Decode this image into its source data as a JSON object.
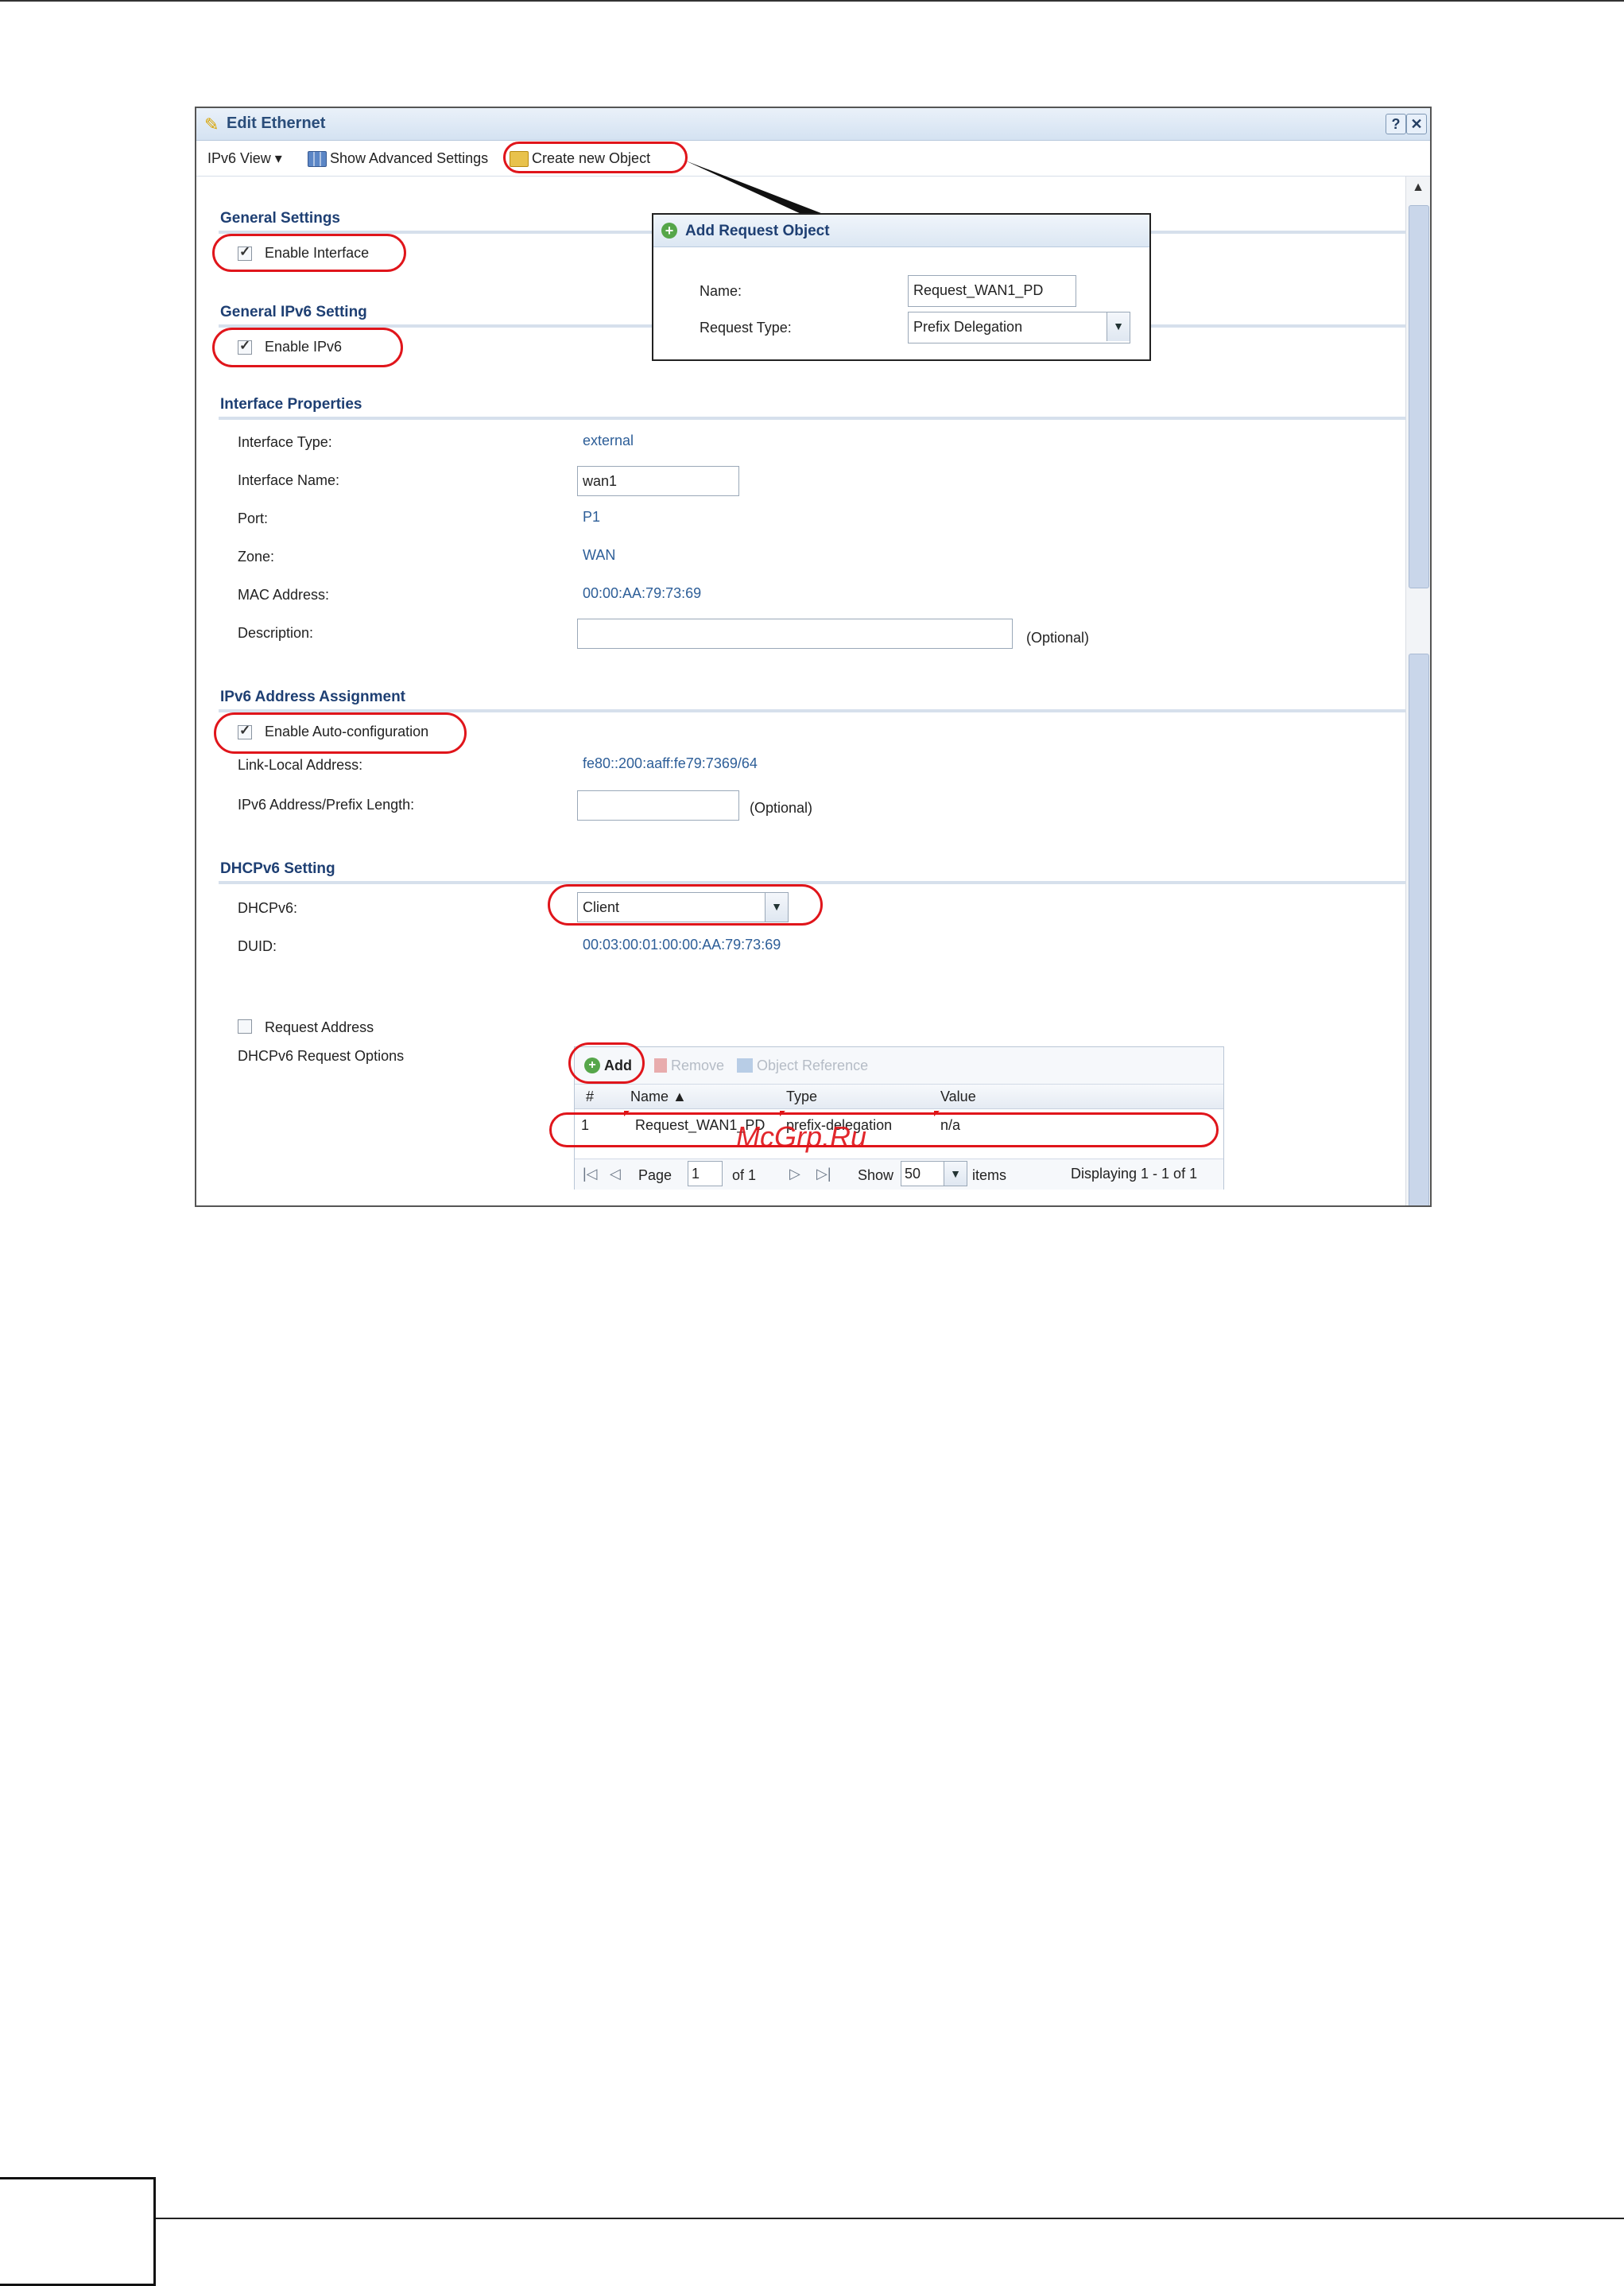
{
  "window": {
    "title": "Edit Ethernet",
    "help_label": "?",
    "close_label": "✕"
  },
  "toolbar": {
    "ipv6_view_label": "IPv6 View ▾",
    "show_advanced_label": "Show Advanced Settings",
    "create_object_label": "Create new Object"
  },
  "general_settings": {
    "title": "General Settings",
    "enable_interface_label": "Enable Interface",
    "enable_interface_checked": true
  },
  "general_ipv6": {
    "title": "General IPv6 Setting",
    "enable_ipv6_label": "Enable IPv6",
    "enable_ipv6_checked": true
  },
  "interface_properties": {
    "title": "Interface Properties",
    "type_label": "Interface Type:",
    "type_value": "external",
    "name_label": "Interface Name:",
    "name_value": "wan1",
    "port_label": "Port:",
    "port_value": "P1",
    "zone_label": "Zone:",
    "zone_value": "WAN",
    "mac_label": "MAC Address:",
    "mac_value": "00:00:AA:79:73:69",
    "description_label": "Description:",
    "description_value": "",
    "description_hint": "(Optional)"
  },
  "ipv6_assignment": {
    "title": "IPv6 Address Assignment",
    "auto_config_label": "Enable Auto-configuration",
    "auto_config_checked": true,
    "link_local_label": "Link-Local Address:",
    "link_local_value": "fe80::200:aaff:fe79:7369/64",
    "prefix_label": "IPv6 Address/Prefix Length:",
    "prefix_value": "",
    "prefix_hint": "(Optional)"
  },
  "dhcpv6": {
    "title": "DHCPv6 Setting",
    "mode_label": "DHCPv6:",
    "mode_value": "Client",
    "duid_label": "DUID:",
    "duid_value": "00:03:00:01:00:00:AA:79:73:69",
    "request_address_label": "Request Address",
    "request_address_checked": false,
    "request_options_label": "DHCPv6 Request Options"
  },
  "request_grid": {
    "add_label": "Add",
    "remove_label": "Remove",
    "object_ref_label": "Object Reference",
    "columns": [
      "#",
      "Name ▲",
      "Type",
      "Value"
    ],
    "rows": [
      {
        "num": "1",
        "name": "Request_WAN1_PD",
        "type": "prefix-delegation",
        "value": "n/a"
      }
    ],
    "page_label": "Page",
    "page_value": "1",
    "of_label": "of 1",
    "show_label": "Show",
    "show_value": "50",
    "items_label": "items",
    "displaying": "Displaying 1 - 1 of 1"
  },
  "popup": {
    "title": "Add Request Object",
    "name_label": "Name:",
    "name_value": "Request_WAN1_PD",
    "type_label": "Request Type:",
    "type_value": "Prefix Delegation"
  },
  "watermark": "McGrp.Ru",
  "colors": {
    "highlight": "#e0151b",
    "section_title": "#1e3f73",
    "value_text": "#2d5e98"
  }
}
